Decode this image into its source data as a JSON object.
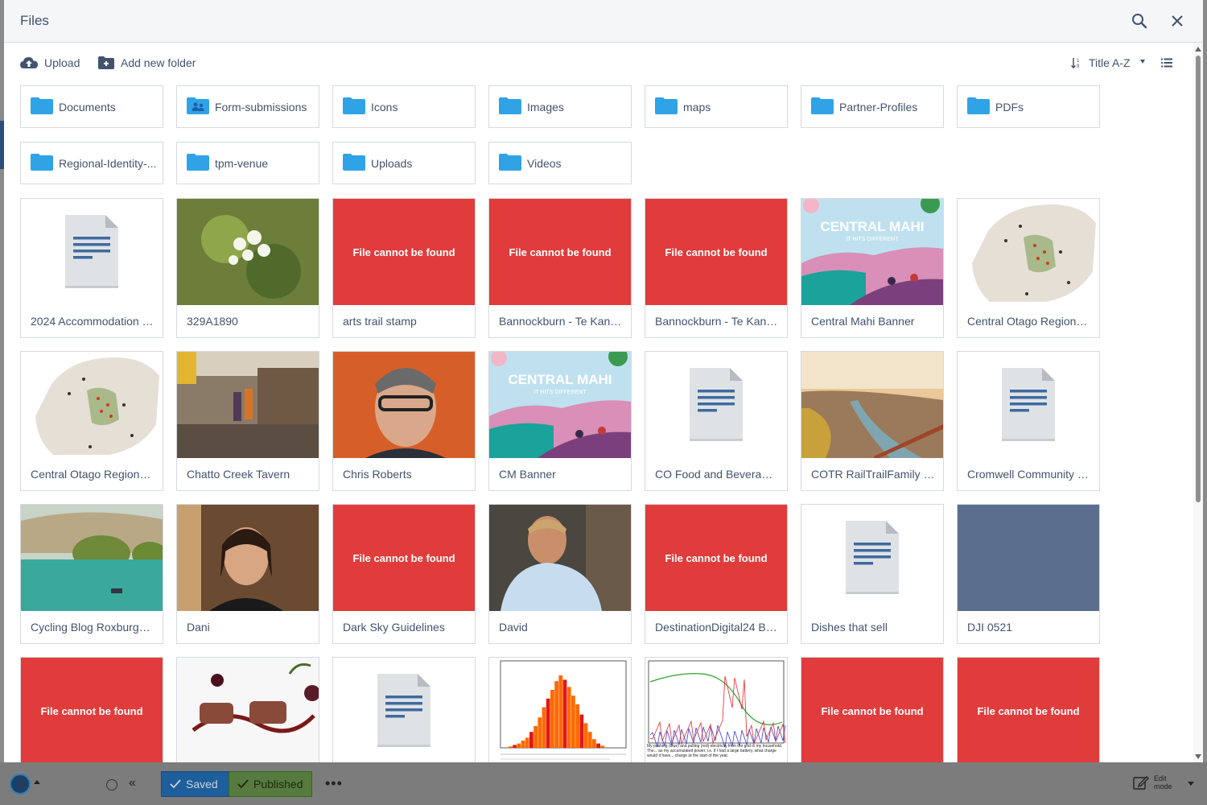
{
  "modal": {
    "title": "Files"
  },
  "toolbar": {
    "upload_label": "Upload",
    "add_folder_label": "Add new folder",
    "sort_label": "Title A-Z"
  },
  "folders": [
    {
      "name": "Documents",
      "icon": "folder-icon"
    },
    {
      "name": "Form-submissions",
      "icon": "user-folder-icon"
    },
    {
      "name": "Icons",
      "icon": "folder-icon"
    },
    {
      "name": "Images",
      "icon": "folder-icon"
    },
    {
      "name": "maps",
      "icon": "folder-icon"
    },
    {
      "name": "Partner-Profiles",
      "icon": "folder-icon"
    },
    {
      "name": "PDFs",
      "icon": "folder-icon"
    },
    {
      "name": "Regional-Identity-...",
      "icon": "folder-icon"
    },
    {
      "name": "tpm-venue",
      "icon": "folder-icon"
    },
    {
      "name": "Uploads",
      "icon": "folder-icon"
    },
    {
      "name": "Videos",
      "icon": "folder-icon"
    }
  ],
  "files": [
    {
      "name": "2024 Accommodation f...",
      "thumb": "doc"
    },
    {
      "name": "329A1890",
      "thumb": "photo-blossom"
    },
    {
      "name": "arts trail stamp",
      "thumb": "missing"
    },
    {
      "name": "Bannockburn - Te Kano...",
      "thumb": "missing"
    },
    {
      "name": "Bannockburn - Te Kano...",
      "thumb": "missing"
    },
    {
      "name": "Central Mahi Banner",
      "thumb": "banner"
    },
    {
      "name": "Central Otago Regional...",
      "thumb": "map"
    },
    {
      "name": "Central Otago Regional...",
      "thumb": "map"
    },
    {
      "name": "Chatto Creek Tavern",
      "thumb": "photo-tavern"
    },
    {
      "name": "Chris Roberts",
      "thumb": "photo-portrait"
    },
    {
      "name": "CM Banner",
      "thumb": "banner"
    },
    {
      "name": "CO Food and Beverage...",
      "thumb": "doc"
    },
    {
      "name": "COTR RailTrailFamily 0...",
      "thumb": "photo-river"
    },
    {
      "name": "Cromwell Community Pl...",
      "thumb": "doc"
    },
    {
      "name": "Cycling Blog Roxburgh ...",
      "thumb": "photo-lake"
    },
    {
      "name": "Dani",
      "thumb": "photo-portrait2"
    },
    {
      "name": "Dark Sky Guidelines",
      "thumb": "missing"
    },
    {
      "name": "David",
      "thumb": "photo-portrait3"
    },
    {
      "name": "DestinationDigital24 By...",
      "thumb": "missing"
    },
    {
      "name": "Dishes that sell",
      "thumb": "doc"
    },
    {
      "name": "DJI 0521",
      "thumb": "slate"
    },
    {
      "name": "",
      "thumb": "missing"
    },
    {
      "name": "",
      "thumb": "photo-food"
    },
    {
      "name": "",
      "thumb": "doc"
    },
    {
      "name": "",
      "thumb": "histogram"
    },
    {
      "name": "",
      "thumb": "linechart"
    },
    {
      "name": "",
      "thumb": "missing"
    },
    {
      "name": "",
      "thumb": "missing"
    }
  ],
  "missing_text": "File cannot be found",
  "banner_text": {
    "title": "CENTRAL MAHI",
    "tagline": "IT HITS DIFFERENT"
  },
  "linechart_caption": "My pushing (blue) and pulling (red) electricity from the grid in my household. The... as my accumulated power, i.e. if I had a large battery, what charge would it have... charge at the start of the year.",
  "bottombar": {
    "saved_label": "Saved",
    "published_label": "Published",
    "edit_mode_label": "Edit mode"
  },
  "colors": {
    "missing": "#e03c3c",
    "folder": "#2fa3e6",
    "text": "#43536d",
    "saved": "#1e5e9a",
    "published": "#577a3e"
  }
}
